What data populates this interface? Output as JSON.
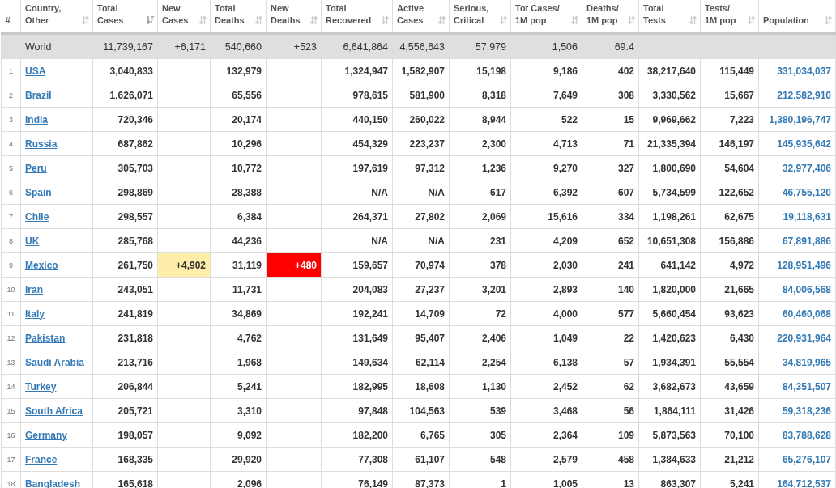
{
  "columns": [
    {
      "lines": [
        "#"
      ]
    },
    {
      "lines": [
        "Country,",
        "Other"
      ],
      "sorted": false
    },
    {
      "lines": [
        "Total",
        "Cases"
      ],
      "sorted": true
    },
    {
      "lines": [
        "New",
        "Cases"
      ],
      "sorted": false
    },
    {
      "lines": [
        "Total",
        "Deaths"
      ],
      "sorted": false
    },
    {
      "lines": [
        "New",
        "Deaths"
      ],
      "sorted": false
    },
    {
      "lines": [
        "Total",
        "Recovered"
      ],
      "sorted": false
    },
    {
      "lines": [
        "Active",
        "Cases"
      ],
      "sorted": false
    },
    {
      "lines": [
        "Serious,",
        "Critical"
      ],
      "sorted": false
    },
    {
      "lines": [
        "Tot Cases/",
        "1M pop"
      ],
      "sorted": false
    },
    {
      "lines": [
        "Deaths/",
        "1M pop"
      ],
      "sorted": false
    },
    {
      "lines": [
        "Total",
        "Tests"
      ],
      "sorted": false
    },
    {
      "lines": [
        "Tests/",
        "1M pop"
      ],
      "sorted": false
    },
    {
      "lines": [
        "Population"
      ],
      "sorted": false
    }
  ],
  "total_row": {
    "country": "World",
    "cells": [
      "11,739,167",
      "+6,171",
      "540,660",
      "+523",
      "6,641,864",
      "4,556,643",
      "57,979",
      "1,506",
      "69.4",
      null,
      null,
      null
    ]
  },
  "rows": [
    {
      "rank": "1",
      "country": "USA",
      "cells": [
        "3,040,833",
        null,
        "132,979",
        null,
        "1,324,947",
        "1,582,907",
        "15,198",
        "9,186",
        "402",
        "38,217,640",
        "115,449",
        "331,034,037"
      ]
    },
    {
      "rank": "2",
      "country": "Brazil",
      "cells": [
        "1,626,071",
        null,
        "65,556",
        null,
        "978,615",
        "581,900",
        "8,318",
        "7,649",
        "308",
        "3,330,562",
        "15,667",
        "212,582,910"
      ]
    },
    {
      "rank": "3",
      "country": "India",
      "cells": [
        "720,346",
        null,
        "20,174",
        null,
        "440,150",
        "260,022",
        "8,944",
        "522",
        "15",
        "9,969,662",
        "7,223",
        "1,380,196,747"
      ]
    },
    {
      "rank": "4",
      "country": "Russia",
      "cells": [
        "687,862",
        null,
        "10,296",
        null,
        "454,329",
        "223,237",
        "2,300",
        "4,713",
        "71",
        "21,335,394",
        "146,197",
        "145,935,642"
      ]
    },
    {
      "rank": "5",
      "country": "Peru",
      "cells": [
        "305,703",
        null,
        "10,772",
        null,
        "197,619",
        "97,312",
        "1,236",
        "9,270",
        "327",
        "1,800,690",
        "54,604",
        "32,977,406"
      ]
    },
    {
      "rank": "6",
      "country": "Spain",
      "cells": [
        "298,869",
        null,
        "28,388",
        null,
        "N/A",
        "N/A",
        "617",
        "6,392",
        "607",
        "5,734,599",
        "122,652",
        "46,755,120"
      ]
    },
    {
      "rank": "7",
      "country": "Chile",
      "cells": [
        "298,557",
        null,
        "6,384",
        null,
        "264,371",
        "27,802",
        "2,069",
        "15,616",
        "334",
        "1,198,261",
        "62,675",
        "19,118,631"
      ]
    },
    {
      "rank": "8",
      "country": "UK",
      "cells": [
        "285,768",
        null,
        "44,236",
        null,
        "N/A",
        "N/A",
        "231",
        "4,209",
        "652",
        "10,651,308",
        "156,886",
        "67,891,886"
      ]
    },
    {
      "rank": "9",
      "country": "Mexico",
      "cells": [
        "261,750",
        "+4,902",
        "31,119",
        "+480",
        "159,657",
        "70,974",
        "378",
        "2,030",
        "241",
        "641,142",
        "4,972",
        "128,951,496"
      ]
    },
    {
      "rank": "10",
      "country": "Iran",
      "cells": [
        "243,051",
        null,
        "11,731",
        null,
        "204,083",
        "27,237",
        "3,201",
        "2,893",
        "140",
        "1,820,000",
        "21,665",
        "84,006,568"
      ]
    },
    {
      "rank": "11",
      "country": "Italy",
      "cells": [
        "241,819",
        null,
        "34,869",
        null,
        "192,241",
        "14,709",
        "72",
        "4,000",
        "577",
        "5,660,454",
        "93,623",
        "60,460,068"
      ]
    },
    {
      "rank": "12",
      "country": "Pakistan",
      "cells": [
        "231,818",
        null,
        "4,762",
        null,
        "131,649",
        "95,407",
        "2,406",
        "1,049",
        "22",
        "1,420,623",
        "6,430",
        "220,931,964"
      ]
    },
    {
      "rank": "13",
      "country": "Saudi Arabia",
      "cells": [
        "213,716",
        null,
        "1,968",
        null,
        "149,634",
        "62,114",
        "2,254",
        "6,138",
        "57",
        "1,934,391",
        "55,554",
        "34,819,965"
      ]
    },
    {
      "rank": "14",
      "country": "Turkey",
      "cells": [
        "206,844",
        null,
        "5,241",
        null,
        "182,995",
        "18,608",
        "1,130",
        "2,452",
        "62",
        "3,682,673",
        "43,659",
        "84,351,507"
      ]
    },
    {
      "rank": "15",
      "country": "South Africa",
      "cells": [
        "205,721",
        null,
        "3,310",
        null,
        "97,848",
        "104,563",
        "539",
        "3,468",
        "56",
        "1,864,111",
        "31,426",
        "59,318,236"
      ]
    },
    {
      "rank": "16",
      "country": "Germany",
      "cells": [
        "198,057",
        null,
        "9,092",
        null,
        "182,200",
        "6,765",
        "305",
        "2,364",
        "109",
        "5,873,563",
        "70,100",
        "83,788,628"
      ]
    },
    {
      "rank": "17",
      "country": "France",
      "cells": [
        "168,335",
        null,
        "29,920",
        null,
        "77,308",
        "61,107",
        "548",
        "2,579",
        "458",
        "1,384,633",
        "21,212",
        "65,276,107"
      ]
    },
    {
      "rank": "18",
      "country": "Bangladesh",
      "cells": [
        "165,618",
        null,
        "2,096",
        null,
        "76,149",
        "87,373",
        "1",
        "1,005",
        "13",
        "863,307",
        "5,241",
        "164,712,537"
      ]
    }
  ]
}
